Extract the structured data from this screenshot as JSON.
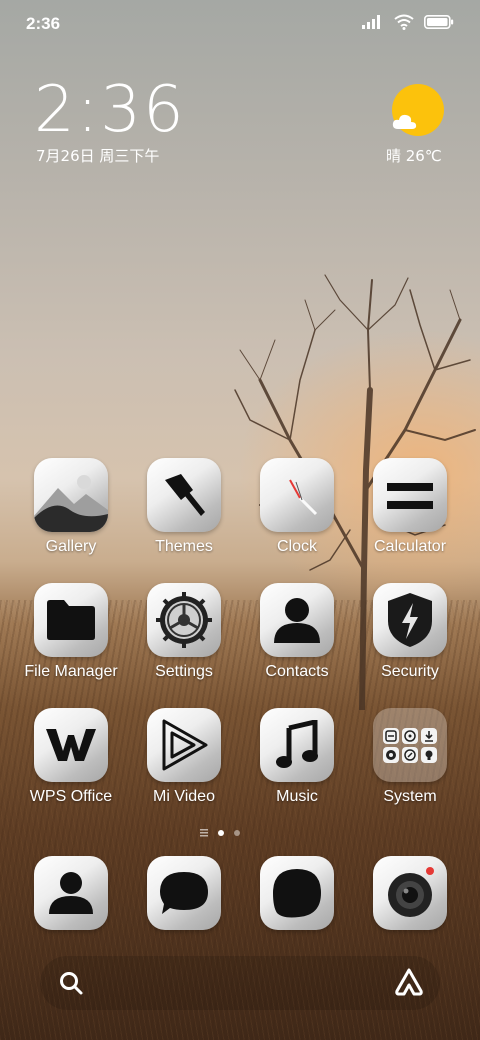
{
  "status_bar": {
    "time": "2:36"
  },
  "clock_widget": {
    "time": "2:36",
    "date": "7月26日 周三下午"
  },
  "weather": {
    "text": "晴 26℃"
  },
  "apps": [
    {
      "label": "Gallery",
      "icon": "gallery-icon"
    },
    {
      "label": "Themes",
      "icon": "brush-icon"
    },
    {
      "label": "Clock",
      "icon": "clock-icon"
    },
    {
      "label": "Calculator",
      "icon": "equals-icon"
    },
    {
      "label": "File Manager",
      "icon": "folder-icon"
    },
    {
      "label": "Settings",
      "icon": "gear-icon"
    },
    {
      "label": "Contacts",
      "icon": "person-icon"
    },
    {
      "label": "Security",
      "icon": "shield-bolt-icon"
    },
    {
      "label": "WPS Office",
      "icon": "wps-icon"
    },
    {
      "label": "Mi Video",
      "icon": "play-icon"
    },
    {
      "label": "Music",
      "icon": "music-note-icon"
    },
    {
      "label": "System",
      "icon": "folder-grid-icon"
    }
  ],
  "dock": [
    {
      "icon": "phone-contact-icon"
    },
    {
      "icon": "message-bubble-icon"
    },
    {
      "icon": "browser-icon"
    },
    {
      "icon": "camera-icon"
    }
  ],
  "page_indicator": {
    "pages": 2,
    "active": 1
  },
  "colors": {
    "sun": "#fcc20c",
    "camera_dot": "#e53935"
  }
}
